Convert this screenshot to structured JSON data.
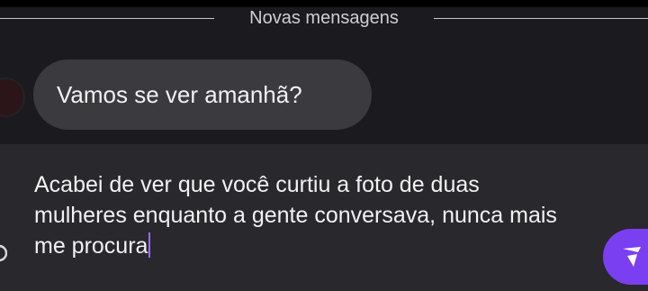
{
  "divider": {
    "label": "Novas mensagens"
  },
  "messages": [
    {
      "text": "Vamos se ver amanhã?"
    }
  ],
  "composer": {
    "value": "Acabei de ver que você curtiu a foto de duas mulheres enquanto a gente conversava, nunca mais me procura"
  },
  "colors": {
    "background": "#1b1b1f",
    "bubble": "#3a3a3f",
    "composer": "#28282d",
    "accent": "#7b3ff2"
  },
  "icons": {
    "send": "send-icon",
    "emoji": "emoji-icon"
  }
}
